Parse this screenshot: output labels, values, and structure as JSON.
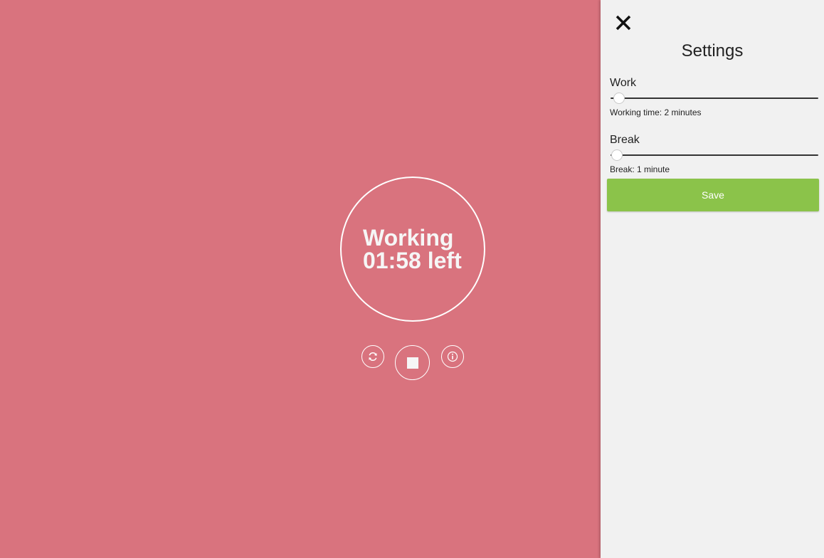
{
  "colors": {
    "main_background": "#d9737e",
    "panel_background": "#f1f1f1",
    "save_button": "#8bc34a",
    "timer_text": "#f6f6f6"
  },
  "timer": {
    "status": "Working",
    "remaining": "01:58 left"
  },
  "controls": {
    "reset_icon": "refresh-icon",
    "stop_icon": "stop-icon",
    "info_icon": "info-icon"
  },
  "settings": {
    "close_icon": "close-icon",
    "title": "Settings",
    "work": {
      "label": "Work",
      "description": "Working time: 2 minutes",
      "slider_fraction": 0.04
    },
    "break": {
      "label": "Break",
      "description": "Break: 1 minute",
      "slider_fraction": 0.03
    },
    "save_label": "Save"
  }
}
